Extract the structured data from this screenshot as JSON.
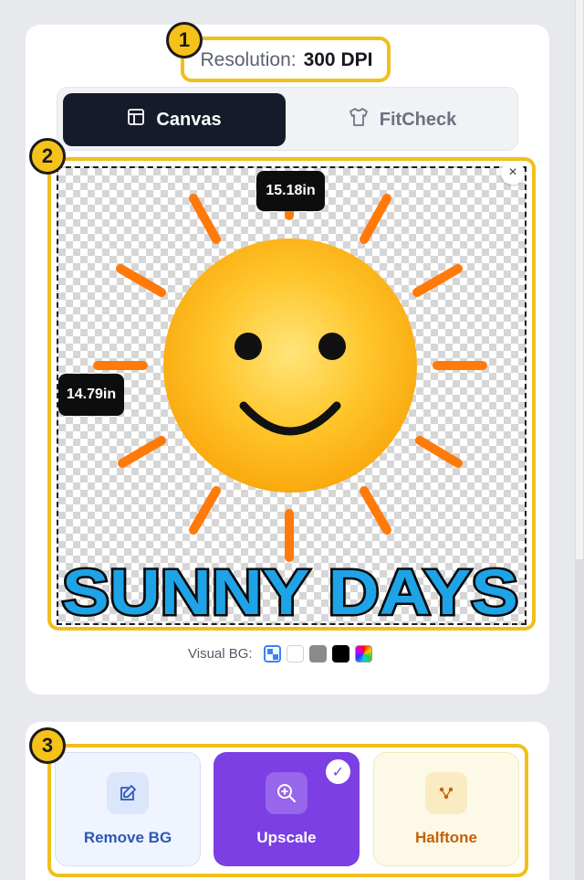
{
  "resolution": {
    "label": "Resolution:",
    "value": "300 DPI"
  },
  "tabs": [
    {
      "label": "Canvas",
      "icon": "layout-icon",
      "active": true
    },
    {
      "label": "FitCheck",
      "icon": "shirt-icon",
      "active": false
    }
  ],
  "canvas": {
    "width_label": "15.18in",
    "height_label": "14.79in",
    "close_symbol": "×",
    "artwork_text": "SUNNY DAYS"
  },
  "visual_bg": {
    "label": "Visual BG:",
    "options": [
      "transparent",
      "white",
      "gray",
      "black",
      "rainbow"
    ],
    "selected": "transparent"
  },
  "actions": [
    {
      "label": "Remove BG",
      "icon": "edit-icon",
      "color": "#2f58b5",
      "selected": false
    },
    {
      "label": "Upscale",
      "icon": "zoom-in-icon",
      "color": "#7b3fe4",
      "selected": true
    },
    {
      "label": "Halftone",
      "icon": "dots-icon",
      "color": "#c2620d",
      "selected": false
    }
  ],
  "annotations": [
    "1",
    "2",
    "3"
  ],
  "colors": {
    "accent_yellow": "#f1bf1c",
    "dark": "#151b2b",
    "purple": "#7b3fe4"
  }
}
